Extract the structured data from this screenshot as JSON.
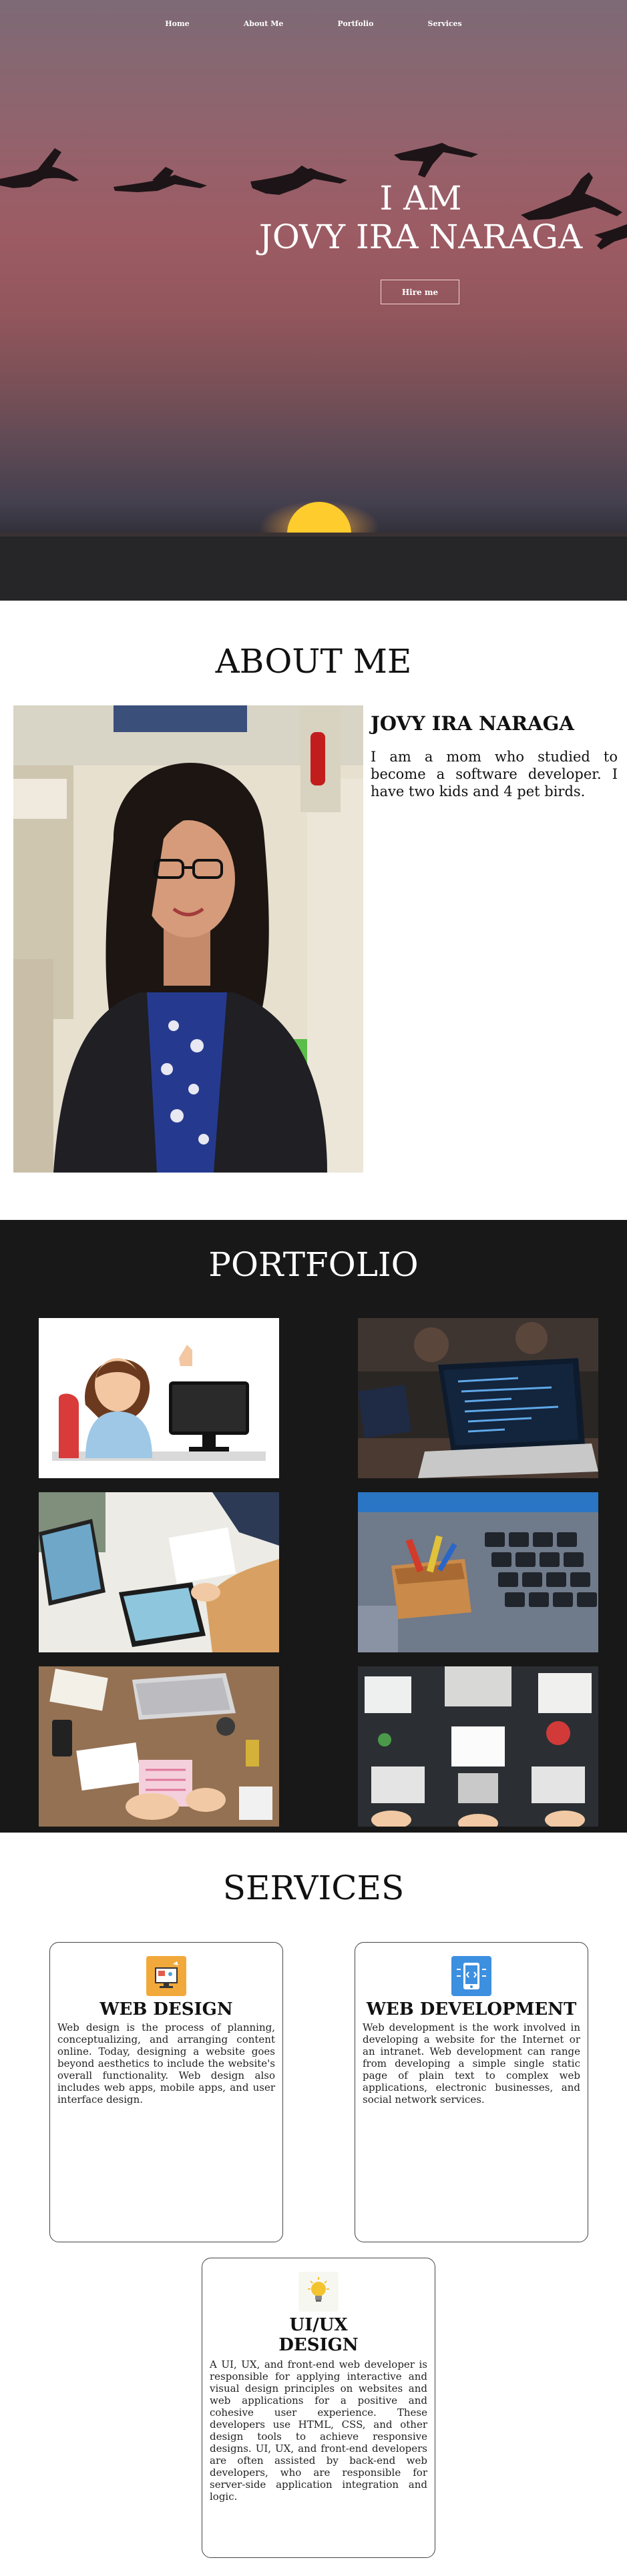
{
  "nav": {
    "items": [
      "Home",
      "About Me",
      "Portfolio",
      "Services"
    ]
  },
  "hero": {
    "line1": "I AM",
    "line2": "JOVY IRA NARAGA",
    "button": "Hire me"
  },
  "about": {
    "heading": "ABOUT ME",
    "name": "JOVY IRA NARAGA",
    "text": "I am a mom who studied to become a software developer. I have two kids and 4 pet birds."
  },
  "portfolio": {
    "heading": "PORTFOLIO",
    "items": [
      "cartoon-woman-computer",
      "laptop-code-workspace",
      "design-desk-tablets",
      "keyboard-toolbox",
      "desk-laptop-planner",
      "team-laptops-desk"
    ]
  },
  "services": {
    "heading": "SERVICES",
    "cards": [
      {
        "title": "WEB DESIGN",
        "text": "Web design is the process of planning, conceptualizing, and arranging content online. Today, designing a website goes beyond aesthetics to include the website's overall functionality. Web design also includes web apps, mobile apps, and user interface design.",
        "icon": "web-design-icon",
        "color": "#f2a93b"
      },
      {
        "title": "WEB DEVELOPMENT",
        "text": "Web development is the work involved in developing a website for the Internet or an intranet. Web development can range from developing a simple single static page of plain text to complex web applications, electronic businesses, and social network services.",
        "icon": "web-development-icon",
        "color": "#3d8fe0"
      },
      {
        "title_line1": "UI/UX",
        "title_line2": "DESIGN",
        "text": "A UI, UX, and front-end web developer is responsible for applying interactive and visual design principles on websites and web applications for a positive and cohesive user experience. These developers use HTML, CSS, and other design tools to achieve responsive designs. UI, UX, and front-end developers are often assisted by back-end web developers, who are responsible for server-side application integration and logic.",
        "icon": "lightbulb-icon",
        "color": "#f4c430"
      }
    ]
  }
}
